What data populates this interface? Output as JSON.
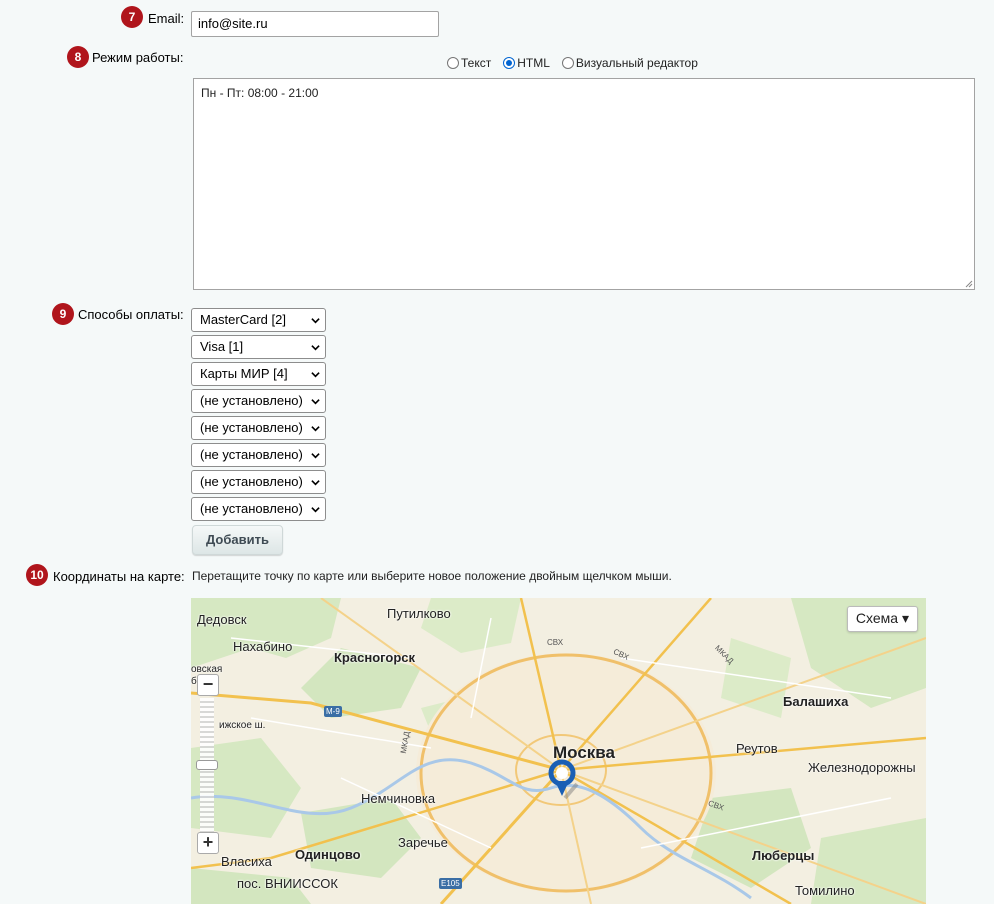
{
  "email": {
    "badge": "7",
    "label": "Email:",
    "value": "info@site.ru"
  },
  "work_hours": {
    "badge": "8",
    "label": "Режим работы:",
    "modes": [
      {
        "label": "Текст",
        "selected": false
      },
      {
        "label": "HTML",
        "selected": true
      },
      {
        "label": "Визуальный редактор",
        "selected": false
      }
    ],
    "value": "Пн - Пт: 08:00 - 21:00"
  },
  "payment": {
    "badge": "9",
    "label": "Способы оплаты:",
    "selects": [
      "MasterCard [2]",
      "Visa [1]",
      "Карты МИР [4]",
      "(не установлено)",
      "(не установлено)",
      "(не установлено)",
      "(не установлено)",
      "(не установлено)"
    ],
    "add_button": "Добавить"
  },
  "coordinates": {
    "badge": "10",
    "label": "Координаты на карте:",
    "hint": "Перетащите точку по карте или выберите новое положение двойным щелчком мыши."
  },
  "map": {
    "type_button": "Схема ▾",
    "zoom_in": "+",
    "zoom_out": "−",
    "places": {
      "dedovsk": "Дедовск",
      "nakhabino": "Нахабино",
      "putilkovo": "Путилково",
      "krasnogorsk": "Красногорск",
      "balashikha": "Балашиха",
      "moskva": "Москва",
      "reutov": "Реутов",
      "zheleznodorozhny": "Железнодорожны",
      "nemchinovka": "Немчиновка",
      "zarechye": "Заречье",
      "odintsovo": "Одинцово",
      "vlasikha": "Власиха",
      "lyubertsy": "Люберцы",
      "vniissok": "пос. ВНИИССОК",
      "tomilino": "Томилино",
      "partial_left_1": "овская",
      "partial_left_2": "бе",
      "highway": "ижское ш."
    },
    "roads": {
      "m9": "М-9",
      "e105": "Е105",
      "mkad_1": "МКАД",
      "mkad_2": "МКАД",
      "cvh_1": "СВХ",
      "cvh_2": "СВХ",
      "cvh_3": "СВХ"
    }
  }
}
